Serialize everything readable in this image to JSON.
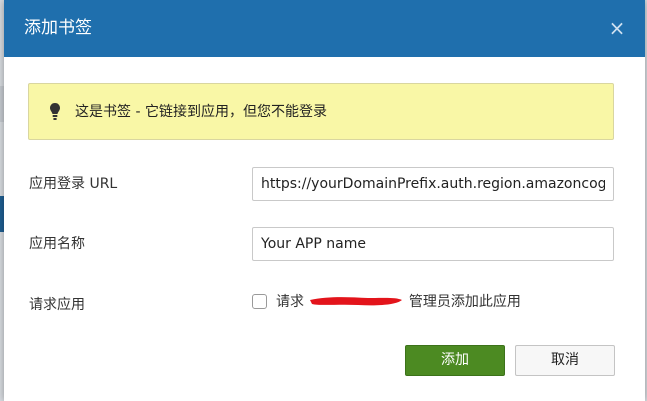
{
  "dialog": {
    "title": "添加书签",
    "close_label": "×"
  },
  "alert": {
    "icon": "lightbulb-icon",
    "text": "这是书签 - 它链接到应用，但您不能登录",
    "bg_color": "#f9f7a6"
  },
  "form": {
    "url_label": "应用登录 URL",
    "url_value": "https://yourDomainPrefix.auth.region.amazoncognito",
    "name_label": "应用名称",
    "name_value": "Your APP name",
    "request_label": "请求应用",
    "request_checkbox_prefix": "请求",
    "request_checkbox_suffix": "管理员添加此应用",
    "request_checked": false
  },
  "actions": {
    "add_label": "添加",
    "cancel_label": "取消"
  },
  "colors": {
    "header": "#1f6fad",
    "primary_button": "#4c8a22",
    "redaction": "#e3141b"
  }
}
